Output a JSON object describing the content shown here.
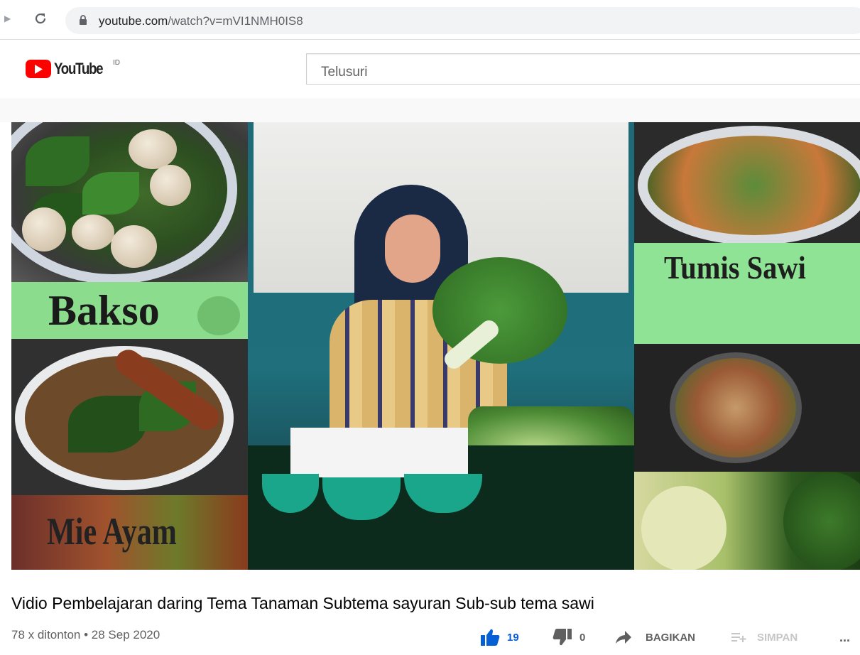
{
  "browser": {
    "url_host": "youtube.com",
    "url_path": "/watch?v=mVI1NMH0IS8",
    "icons": [
      "forward-icon",
      "reload-icon",
      "lock-icon"
    ]
  },
  "header": {
    "logo_text": "YouTube",
    "country_code": "ID",
    "search_placeholder": "Telusuri"
  },
  "video": {
    "thumbnail_labels": {
      "top_left": "Bakso",
      "bottom_left": "Mie Ayam",
      "top_right": "Tumis Sawi"
    },
    "title": "Vidio Pembelajaran daring Tema Tanaman Subtema sayuran Sub-sub tema sawi",
    "views": "78 x ditonton",
    "separator": "•",
    "date": "28 Sep 2020"
  },
  "actions": {
    "like_count": "19",
    "dislike_count": "0",
    "share_label": "BAGIKAN",
    "save_label": "SIMPAN",
    "more_label": "..."
  },
  "colors": {
    "brand_red": "#ff0000",
    "like_active": "#065fd4",
    "text_primary": "#030303",
    "text_secondary": "#606060"
  }
}
